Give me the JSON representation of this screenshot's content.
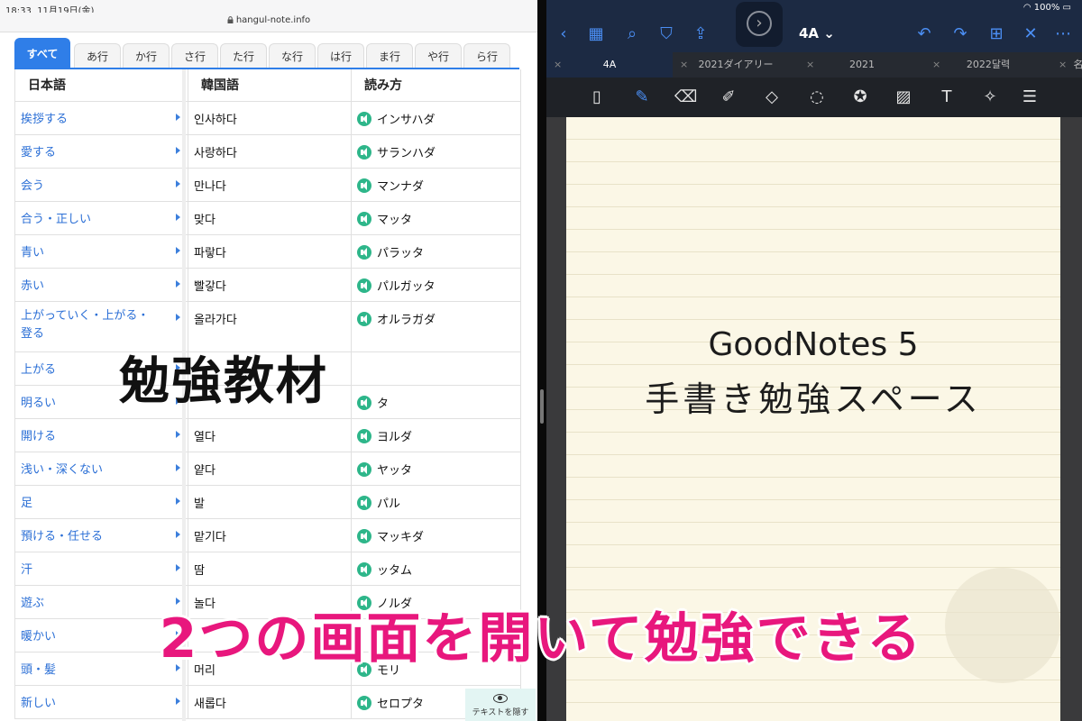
{
  "safari": {
    "status_time": "18:33",
    "status_date": "11月19日(金)",
    "url": "hangul-note.info",
    "tabs": [
      "すべて",
      "あ行",
      "か行",
      "さ行",
      "た行",
      "な行",
      "は行",
      "ま行",
      "や行",
      "ら行"
    ],
    "active_tab": "すべて",
    "table": {
      "headers": [
        "日本語",
        "韓国語",
        "読み方"
      ],
      "rows": [
        {
          "ja": "挨拶する",
          "ko": "인사하다",
          "yomi": "インサハダ"
        },
        {
          "ja": "愛する",
          "ko": "사랑하다",
          "yomi": "サランハダ"
        },
        {
          "ja": "会う",
          "ko": "만나다",
          "yomi": "マンナダ"
        },
        {
          "ja": "合う・正しい",
          "ko": "맞다",
          "yomi": "マッタ"
        },
        {
          "ja": "青い",
          "ko": "파랗다",
          "yomi": "パラッタ"
        },
        {
          "ja": "赤い",
          "ko": "빨갛다",
          "yomi": "パルガッタ"
        },
        {
          "ja": "上がっていく・上がる・\n登る",
          "ko": "올라가다",
          "yomi": "オルラガダ"
        },
        {
          "ja": "上がる",
          "ko": "",
          "yomi": ""
        },
        {
          "ja": "明るい",
          "ko": "",
          "yomi": "タ"
        },
        {
          "ja": "開ける",
          "ko": "열다",
          "yomi": "ヨルダ"
        },
        {
          "ja": "浅い・深くない",
          "ko": "얕다",
          "yomi": "ヤッタ"
        },
        {
          "ja": "足",
          "ko": "발",
          "yomi": "パル"
        },
        {
          "ja": "預ける・任せる",
          "ko": "맡기다",
          "yomi": "マッキダ"
        },
        {
          "ja": "汗",
          "ko": "땀",
          "yomi": "ッタム"
        },
        {
          "ja": "遊ぶ",
          "ko": "놀다",
          "yomi": "ノルダ"
        },
        {
          "ja": "暖かい",
          "ko": "",
          "yomi": ""
        },
        {
          "ja": "頭・髪",
          "ko": "머리",
          "yomi": "モリ"
        },
        {
          "ja": "新しい",
          "ko": "새롭다",
          "yomi": "セロプタ"
        }
      ]
    },
    "hide_text_label": "テキストを隠す"
  },
  "goodnotes": {
    "status_right": "100%",
    "doc_title": "4A ⌄",
    "tabs": [
      "4A",
      "2021ダイアリー",
      "2021",
      "2022달력",
      "名"
    ],
    "active_tab": "4A",
    "note_line1": "GoodNotes 5",
    "note_line2": "手書き勉強スペース"
  },
  "overlays": {
    "study_label": "勉強教材",
    "caption": "2つの画面を開いて勉強できる"
  },
  "colors": {
    "safari_accent": "#2f7ee8",
    "ja_link": "#2b6fd6",
    "speaker_green": "#2eb68a",
    "goodnotes_bar": "#1c2a43",
    "goodnotes_accent": "#4b8ff5",
    "paper": "#fbf7e6",
    "caption_pink": "#e8177d"
  },
  "icons": [
    "lock-icon",
    "chevron-right-icon",
    "speaker-icon",
    "eye-icon",
    "back-icon",
    "grid-icon",
    "search-icon",
    "bookmark-icon",
    "share-icon",
    "forward-arrow-icon",
    "undo-icon",
    "redo-icon",
    "add-page-icon",
    "close-icon",
    "more-icon",
    "wifi-icon",
    "battery-icon",
    "pen-icon",
    "eraser-icon",
    "highlighter-icon",
    "shapes-icon",
    "lasso-icon",
    "sticker-icon",
    "image-icon",
    "textbox-icon",
    "laser-pointer-icon",
    "color-picker-icon"
  ]
}
